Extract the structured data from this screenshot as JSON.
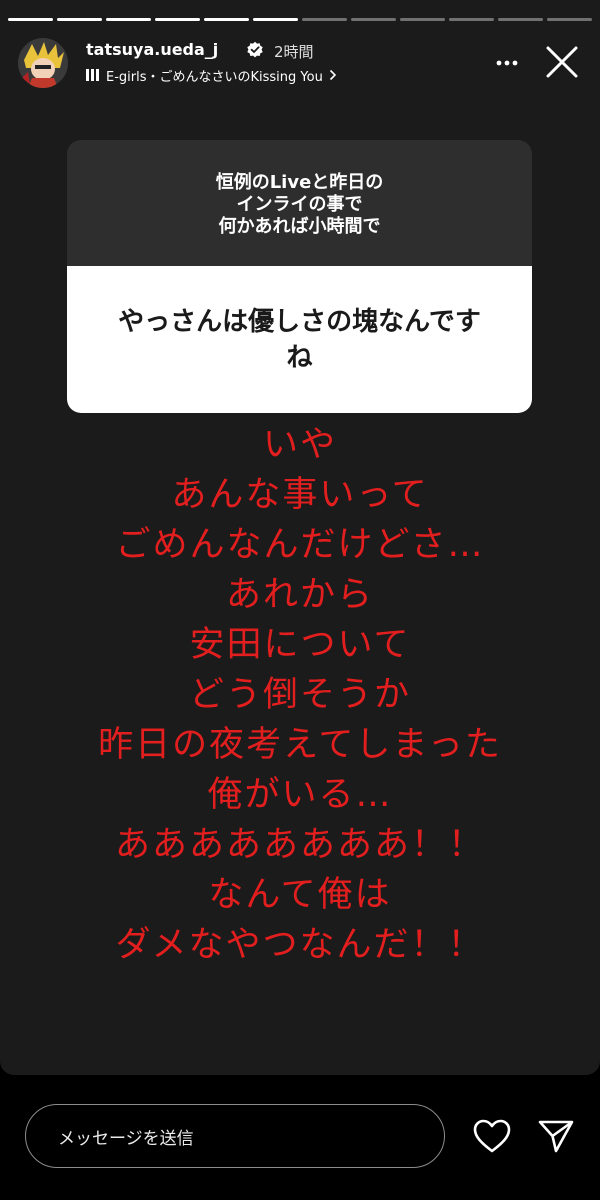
{
  "story": {
    "progress": {
      "segments_total": 12,
      "segments_done": 6
    },
    "header": {
      "username": "tatsuya.ueda_j",
      "time": "2時間",
      "music": "E-girls・ごめんなさいのKissing You",
      "icons": [
        "avatar",
        "verified-badge-icon",
        "music-bars-icon",
        "chevron-right-icon",
        "more-icon",
        "close-icon"
      ]
    },
    "question": {
      "prompt_lines": [
        "恒例のLiveと昨日の",
        "インライの事で",
        "何かあれば小時間で"
      ],
      "answer_lines": [
        "やっさんは優しさの塊なんです",
        "ね"
      ]
    },
    "reply_lines": [
      "いや",
      "あんな事いって",
      "ごめんなんだけどさ…",
      "あれから",
      "安田について",
      "どう倒そうか",
      "昨日の夜考えてしまった",
      "俺がいる…",
      "ああああああああ！！",
      "なんて俺は",
      "ダメなやつなんだ！！"
    ],
    "colors": {
      "reply_text": "#e21e1e",
      "card_background": "#1b1b1b",
      "sticker_header": "#2e2e2e"
    }
  },
  "footer": {
    "message_placeholder": "メッセージを送信",
    "icons": [
      "heart-icon",
      "send-icon"
    ]
  }
}
